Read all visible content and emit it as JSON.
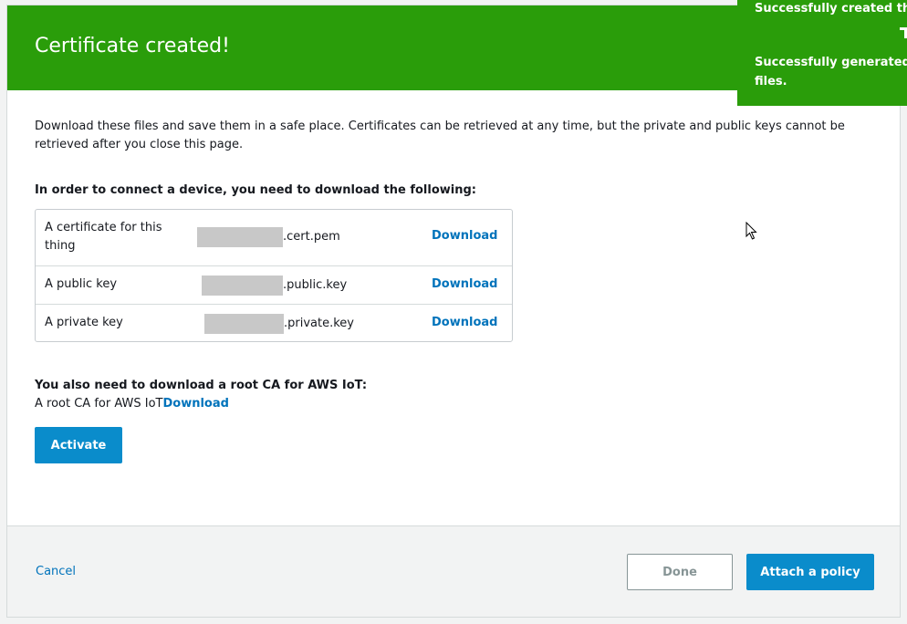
{
  "header": {
    "title": "Certificate created!"
  },
  "intro": "Download these files and save them in a safe place. Certificates can be retrieved at any time, but the private and public keys cannot be retrieved after you close this page.",
  "instructions": "In order to connect a device, you need to download the following:",
  "files": [
    {
      "label": "A certificate for this thing",
      "suffix": ".cert.pem",
      "action": "Download"
    },
    {
      "label": "A public key",
      "suffix": ".public.key",
      "action": "Download"
    },
    {
      "label": "A private key",
      "suffix": ".private.key",
      "action": "Download"
    }
  ],
  "root_ca": {
    "heading": "You also need to download a root CA for AWS IoT:",
    "label": "A root CA for AWS IoT",
    "action": "Download"
  },
  "activate_label": "Activate",
  "footer": {
    "cancel_label": "Cancel",
    "done_label": "Done",
    "attach_label": "Attach a policy"
  },
  "toasts": [
    {
      "text": "Successfully created thing."
    },
    {
      "text": "Successfully generated ce",
      "text_line2": "files."
    }
  ],
  "colors": {
    "success_green": "#2a9d0a",
    "primary_blue": "#0a8ccb",
    "link_blue": "#0073bb"
  }
}
